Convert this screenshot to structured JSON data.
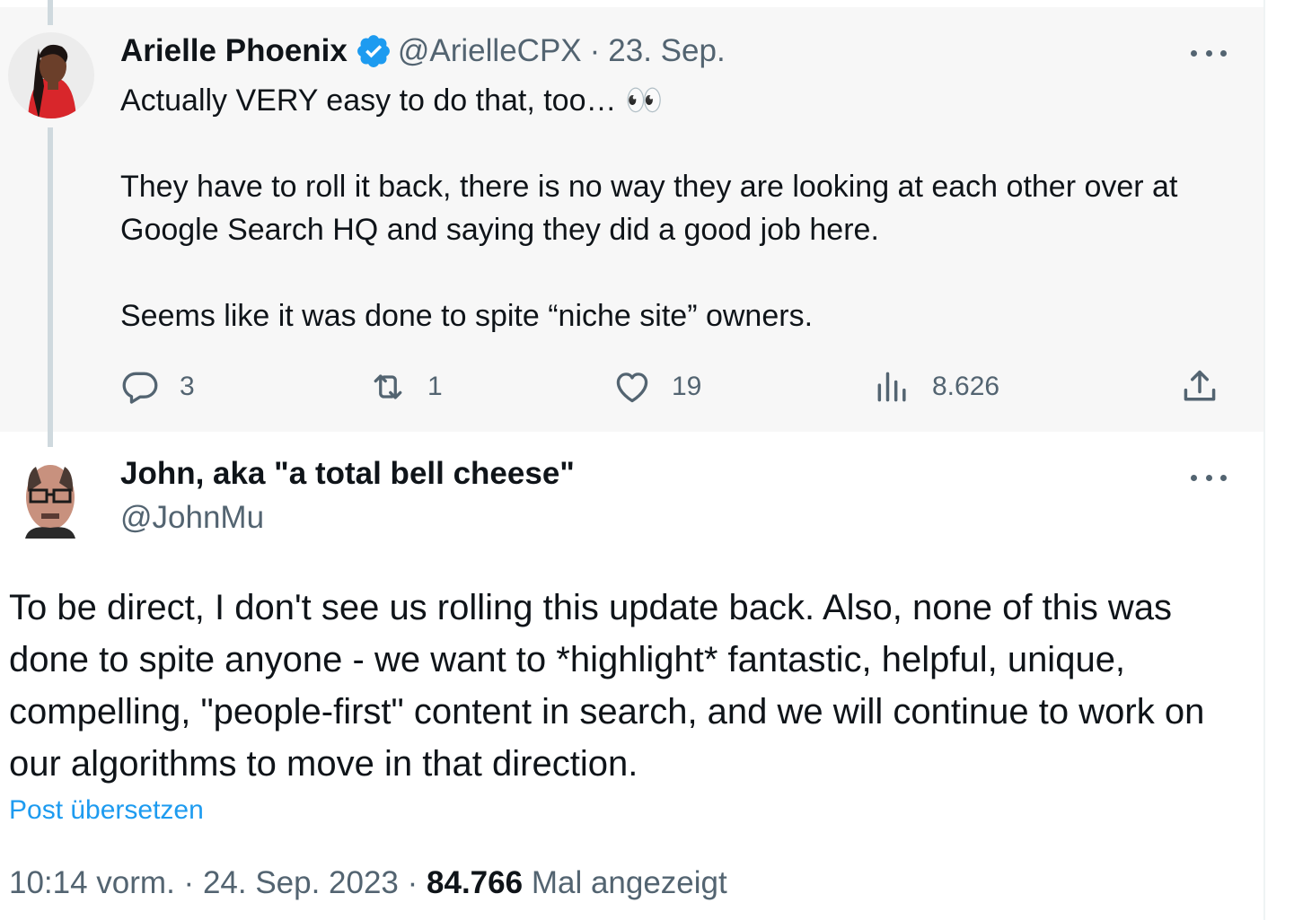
{
  "quoted_tweet": {
    "author_name": "Arielle Phoenix",
    "handle": "@ArielleCPX",
    "separator": "·",
    "date": "23. Sep.",
    "paragraphs": [
      "Actually VERY easy to do that, too… 👀",
      "They have to roll it back, there is no way they are looking at each other over at Google Search HQ and saying they did a good job here.",
      "Seems like it was done to spite “niche site” owners."
    ],
    "actions": {
      "replies": "3",
      "reposts": "1",
      "likes": "19",
      "views": "8.626"
    },
    "icons": [
      "verified-badge-icon",
      "more-icon",
      "reply-icon",
      "repost-icon",
      "like-icon",
      "views-icon",
      "share-icon"
    ]
  },
  "main_tweet": {
    "author_name": "John, aka \"a total bell cheese\"",
    "handle": "@JohnMu",
    "text": "To be direct, I don't see us rolling this update back. Also, none of this was done to spite anyone - we want to *highlight* fantastic, helpful, unique, compelling, \"people-first\" content in search, and we will continue to work on our algorithms to move in that direction.",
    "translate_link": "Post übersetzen",
    "time": "10:14 vorm.",
    "date": "24. Sep. 2023",
    "separator": "·",
    "views_count": "84.766",
    "views_label": "Mal angezeigt"
  },
  "colors": {
    "accent": "#1d9bf0",
    "muted_text": "#536471",
    "primary_text": "#0f1419",
    "quoted_background": "#f7f7f7"
  }
}
